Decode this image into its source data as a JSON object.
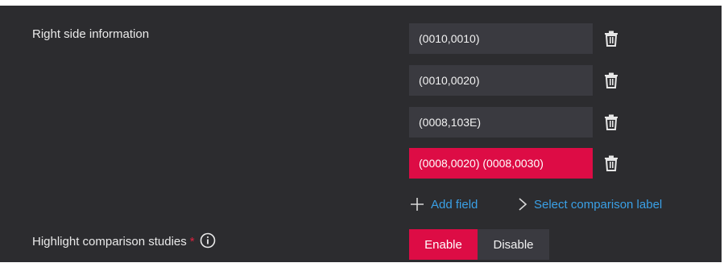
{
  "section": {
    "right_side_label": "Right side information",
    "fields": [
      {
        "value": "(0010,0010)"
      },
      {
        "value": "(0010,0020)"
      },
      {
        "value": "(0008,103E)"
      },
      {
        "value": "(0008,0020) (0008,0030)"
      }
    ],
    "add_field_label": "Add field",
    "select_comparison_label": "Select comparison label"
  },
  "highlight": {
    "label": "Highlight comparison studies",
    "required_marker": "*",
    "enable_label": "Enable",
    "disable_label": "Disable",
    "selected": "Enable"
  },
  "colors": {
    "panel_bg": "#2c2c2f",
    "field_bg": "#3a3a40",
    "accent": "#dd0c45",
    "link": "#3aa0e6"
  },
  "icons": {
    "delete": "trash-icon",
    "add": "plus-icon",
    "select": "chevron-right-icon",
    "info": "info-icon"
  }
}
